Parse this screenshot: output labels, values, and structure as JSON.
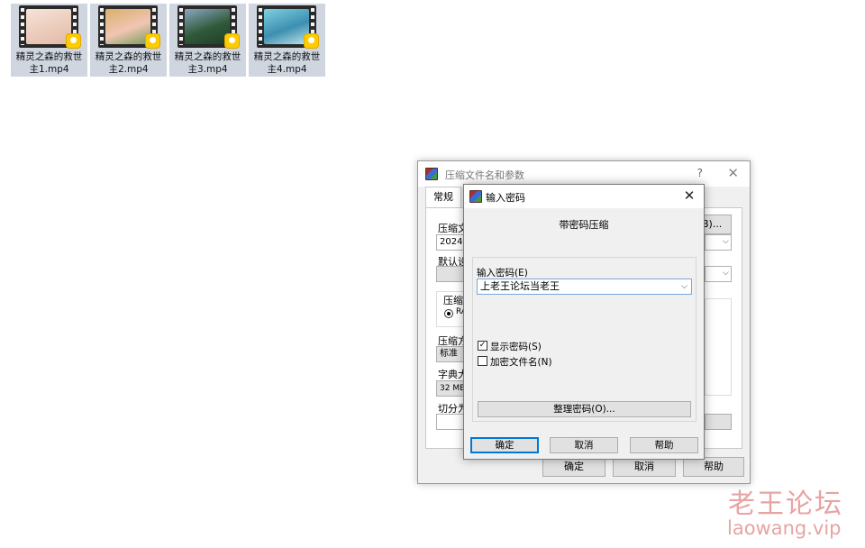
{
  "files": [
    {
      "name": "精灵之森的救世主1.mp4",
      "thumb_color": "#e9c9b8"
    },
    {
      "name": "精灵之森的救世主2.mp4",
      "thumb_color": "#d9b28a"
    },
    {
      "name": "精灵之森的救世主3.mp4",
      "thumb_color": "#3e6a47"
    },
    {
      "name": "精灵之森的救世主4.mp4",
      "thumb_color": "#5fb0c8"
    }
  ],
  "back_dialog": {
    "title": "压缩文件名和参数",
    "help": "?",
    "close": "✕",
    "tab_general": "常规",
    "archive_label": "压缩文",
    "archive_value": "202428",
    "browse_partial": "(B)...",
    "profile_label": "默认设",
    "format_group": "压缩",
    "format_rar": "RA",
    "method_label": "压缩方",
    "method_value": "标准",
    "dict_label": "字典大",
    "dict_value": "32 MB",
    "split_label": "切分为",
    "ok": "确定",
    "cancel": "取消",
    "help_btn": "帮助"
  },
  "password_dialog": {
    "title": "输入密码",
    "heading": "带密码压缩",
    "password_label": "输入密码(E)",
    "password_value": "上老王论坛当老王",
    "show_password": "显示密码(S)",
    "show_password_checked": true,
    "encrypt_names": "加密文件名(N)",
    "encrypt_names_checked": false,
    "organize_btn": "整理密码(O)...",
    "ok": "确定",
    "cancel": "取消",
    "help": "帮助"
  },
  "watermark": {
    "title": "老王论坛",
    "url": "laowang.vip"
  }
}
